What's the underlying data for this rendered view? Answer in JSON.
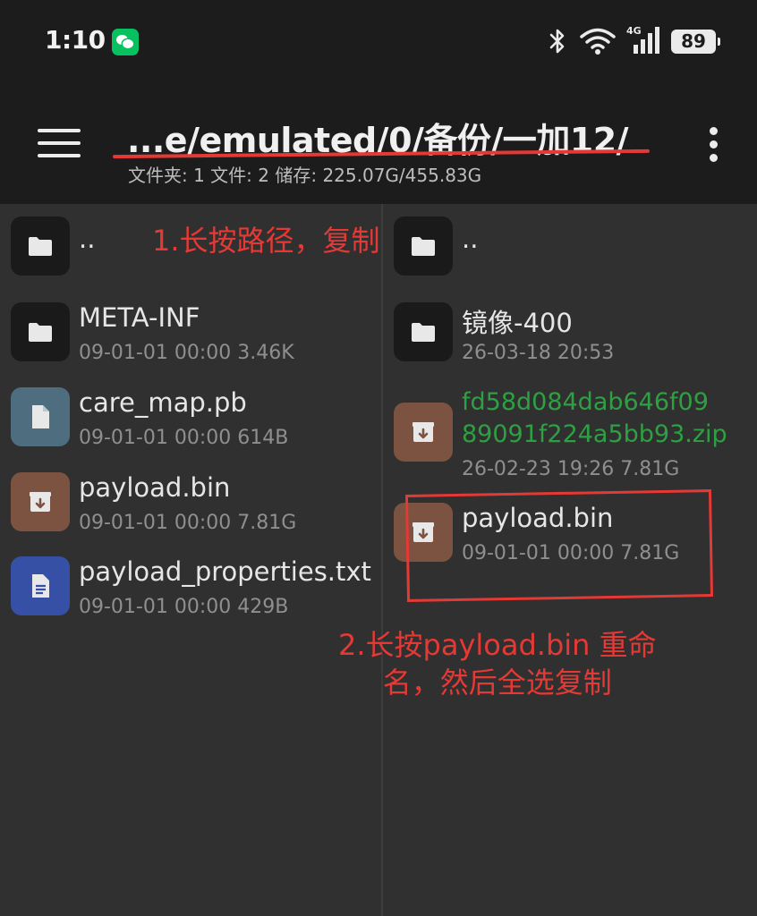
{
  "status_bar": {
    "time": "1:10",
    "network": "4G",
    "battery": "89",
    "icons": [
      "wechat-icon",
      "bluetooth-icon",
      "wifi-icon",
      "cellular-signal-icon",
      "battery-icon"
    ]
  },
  "toolbar": {
    "path": "...e/emulated/0/备份/一加12/",
    "summary": "文件夹: 1  文件: 2  储存: 225.07G/455.83G"
  },
  "left_pane": {
    "items": [
      {
        "name": "..",
        "meta": "",
        "icon": "folder-icon"
      },
      {
        "name": "META-INF",
        "meta": "09-01-01 00:00  3.46K",
        "icon": "folder-icon"
      },
      {
        "name": "care_map.pb",
        "meta": "09-01-01 00:00  614B",
        "icon": "file-icon"
      },
      {
        "name": "payload.bin",
        "meta": "09-01-01 00:00  7.81G",
        "icon": "archive-icon"
      },
      {
        "name": "payload_properties.txt",
        "meta": "09-01-01 00:00  429B",
        "icon": "text-file-icon"
      }
    ]
  },
  "right_pane": {
    "items": [
      {
        "name": "..",
        "meta": "",
        "icon": "folder-icon"
      },
      {
        "name": "镜像-400",
        "meta": "26-03-18 20:53",
        "icon": "folder-icon"
      },
      {
        "name_line1": "fd58d084dab646f09",
        "name_line2": "89091f224a5bb93.zip",
        "meta": "26-02-23 19:26  7.81G",
        "icon": "archive-icon"
      },
      {
        "name": "payload.bin",
        "meta": "09-01-01 00:00  7.81G",
        "icon": "archive-icon"
      }
    ]
  },
  "annotations": {
    "step1": "1.长按路径，复制",
    "step2_line1": "2.长按payload.bin 重命",
    "step2_line2": "名，然后全选复制"
  },
  "colors": {
    "annotation": "#e53935",
    "zip_name": "#2ea043",
    "folder_icon_bg": "#1a1a1a",
    "archive_icon_bg": "#7c5341",
    "file_icon_bg": "#4e6e80",
    "text_icon_bg": "#3550a5"
  }
}
